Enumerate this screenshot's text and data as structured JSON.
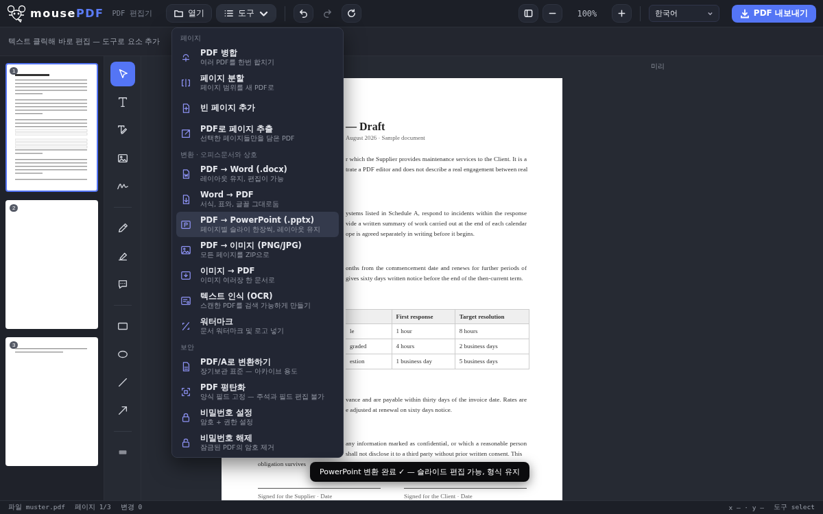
{
  "app": {
    "brand_prefix": "mouse",
    "brand_suffix": "PDF",
    "subtitle": "PDF 편집기"
  },
  "toolbar": {
    "open_label": "열기",
    "tools_label": "도구",
    "tools_expanded": true,
    "redo_disabled": true,
    "zoom": "100%",
    "language": "한국어",
    "export_label": "PDF 내보내기"
  },
  "hint": "텍스트 클릭해 바로 편집 — 도구로 요소 추가",
  "thumbnails": [
    {
      "number": "1",
      "selected": true,
      "kind": "full"
    },
    {
      "number": "2",
      "selected": false,
      "kind": "blank"
    },
    {
      "number": "3",
      "selected": false,
      "kind": "brief"
    }
  ],
  "tool_groups": [
    [
      {
        "kind": "select",
        "selected": true
      },
      {
        "kind": "text",
        "selected": false
      },
      {
        "kind": "edit-text",
        "selected": false
      },
      {
        "kind": "image",
        "selected": false
      },
      {
        "kind": "signature",
        "selected": false
      }
    ],
    [
      {
        "kind": "pen",
        "selected": false
      },
      {
        "kind": "highlighter",
        "selected": false
      },
      {
        "kind": "comment",
        "selected": false
      }
    ],
    [
      {
        "kind": "rectangle",
        "selected": false
      },
      {
        "kind": "ellipse",
        "selected": false
      },
      {
        "kind": "line",
        "selected": false
      },
      {
        "kind": "arrow",
        "selected": false
      }
    ],
    [
      {
        "kind": "swatch",
        "selected": false
      }
    ]
  ],
  "menu": {
    "sections": [
      {
        "heading": "페이지",
        "items": [
          {
            "kind": "merge",
            "title": "PDF 병합",
            "subtitle": "여러 PDF를 한번 합치기",
            "selected": false
          },
          {
            "kind": "split",
            "title": "페이지 분할",
            "subtitle": "페이지 범위를 새 PDF로",
            "selected": false
          },
          {
            "kind": "page-add",
            "title": "빈 페이지 추가",
            "selected": false
          },
          {
            "kind": "extract",
            "title": "PDF로 페이지 추출",
            "subtitle": "선택한 페이지들만을 담은 PDF",
            "selected": false
          }
        ]
      },
      {
        "heading": "변환 · 오피스문서와 상호",
        "items": [
          {
            "kind": "to-word",
            "title": "PDF → Word (.docx)",
            "subtitle": "레이아웃 유지, 편집이 가능",
            "selected": false
          },
          {
            "kind": "from-word",
            "title": "Word → PDF",
            "subtitle": "서식, 표와, 글꼴 그대로둠",
            "selected": false
          },
          {
            "kind": "to-ppt",
            "title": "PDF → PowerPoint (.pptx)",
            "subtitle": "페이지별 슬라이 한장씩, 레이아웃 유지",
            "selected": true
          },
          {
            "kind": "to-image",
            "title": "PDF → 이미지 (PNG/JPG)",
            "subtitle": "모든 페이지를 ZIP으로",
            "selected": false
          },
          {
            "kind": "from-image",
            "title": "이미지 → PDF",
            "subtitle": "이미지 여러장 한 문서로",
            "selected": false
          },
          {
            "kind": "ocr",
            "title": "텍스트 인식 (OCR)",
            "subtitle": "스캔한 PDF를 검색 가능하게 만들기",
            "selected": false
          },
          {
            "kind": "watermark",
            "title": "워터마크",
            "subtitle": "문서 워터마크 및 로고 넣기",
            "selected": false
          }
        ]
      },
      {
        "heading": "보안",
        "items": [
          {
            "kind": "archive",
            "title": "PDF/A로 변환하기",
            "subtitle": "장기보관 표준 — 아카이브 용도",
            "selected": false
          },
          {
            "kind": "flatten",
            "title": "PDF 평탄화",
            "subtitle": "양식 필드 고정 — 주석과 필드 편집 불가",
            "selected": false
          },
          {
            "kind": "lock",
            "title": "비밀번호 설정",
            "subtitle": "암호 + 권한 설정",
            "selected": false
          },
          {
            "kind": "unlock",
            "title": "비밀번호 해제",
            "subtitle": "잠금된 PDF의 암호 제거",
            "selected": false
          }
        ]
      }
    ]
  },
  "canvas_label": "미리",
  "document": {
    "title": "— Draft",
    "meta": "August 2026 · Sample document",
    "paragraphs": [
      {
        "lines": [
          "r which the Supplier provides maintenance services to the Client. It is a",
          "trate a PDF editor and does not describe a real engagement between real"
        ]
      },
      {
        "lines": [
          "ystems listed in Schedule A, respond to incidents within the response",
          "vide a written summary of work carried out at the end of each calendar",
          "ope is agreed separately in writing before it begins."
        ]
      },
      {
        "lines": [
          "onths from the commencement date and renews for further periods of",
          "gives sixty days written notice before the end of the then-current term."
        ]
      }
    ],
    "table": {
      "columns": [
        "",
        "First response",
        "Target resolution"
      ],
      "rows": [
        [
          "le",
          "1 hour",
          "8 hours"
        ],
        [
          "graded",
          "4 hours",
          "2 business days"
        ],
        [
          "estion",
          "1 business day",
          "5 business days"
        ]
      ]
    },
    "paragraphs_after": [
      {
        "lines": [
          "vance and are payable within thirty days of the invoice date. Rates are",
          "e adjusted at renewal on sixty days notice."
        ]
      },
      {
        "lines": [
          "any information marked as confidential, or which a reasonable person",
          "shall not disclose it to a third party without prior written consent. This"
        ]
      }
    ],
    "last_line": "obligation survives",
    "signatures": [
      "Signed for the Supplier · Date",
      "Signed for the Client · Date"
    ]
  },
  "toast": "PowerPoint 변환 완료 ✓ — 슬라이드 편집 가능, 형식 유지",
  "status": {
    "file": "파일 muster.pdf",
    "page": "페이지 1/3",
    "changes": "변경 0",
    "coords": "x – · y –",
    "mode": "도구 select"
  }
}
